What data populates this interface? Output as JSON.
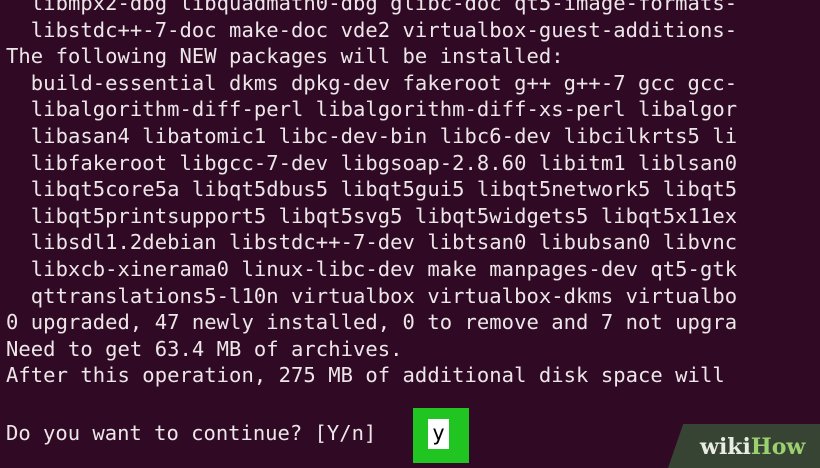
{
  "terminal": {
    "lines": [
      "  libmpx2-dbg libquadmath0-dbg glibc-doc qt5-image-formats-",
      "  libstdc++-7-doc make-doc vde2 virtualbox-guest-additions-",
      "The following NEW packages will be installed:",
      "  build-essential dkms dpkg-dev fakeroot g++ g++-7 gcc gcc-",
      "  libalgorithm-diff-perl libalgorithm-diff-xs-perl libalgor",
      "  libasan4 libatomic1 libc-dev-bin libc6-dev libcilkrts5 li",
      "  libfakeroot libgcc-7-dev libgsoap-2.8.60 libitm1 liblsan0",
      "  libqt5core5a libqt5dbus5 libqt5gui5 libqt5network5 libqt5",
      "  libqt5printsupport5 libqt5svg5 libqt5widgets5 libqt5x11ex",
      "  libsdl1.2debian libstdc++-7-dev libtsan0 libubsan0 libvnc",
      "  libxcb-xinerama0 linux-libc-dev make manpages-dev qt5-gtk",
      "  qttranslations5-l10n virtualbox virtualbox-dkms virtualbo",
      "0 upgraded, 47 newly installed, 0 to remove and 7 not upgra",
      "Need to get 63.4 MB of archives.",
      "After this operation, 275 MB of additional disk space will "
    ],
    "prompt": "Do you want to continue? [Y/n] ",
    "answer": "y"
  },
  "watermark": {
    "part1": "wiki",
    "part2": "How"
  },
  "colors": {
    "background": "#300a24",
    "text": "#ece6e9",
    "highlight": "#21c521"
  }
}
